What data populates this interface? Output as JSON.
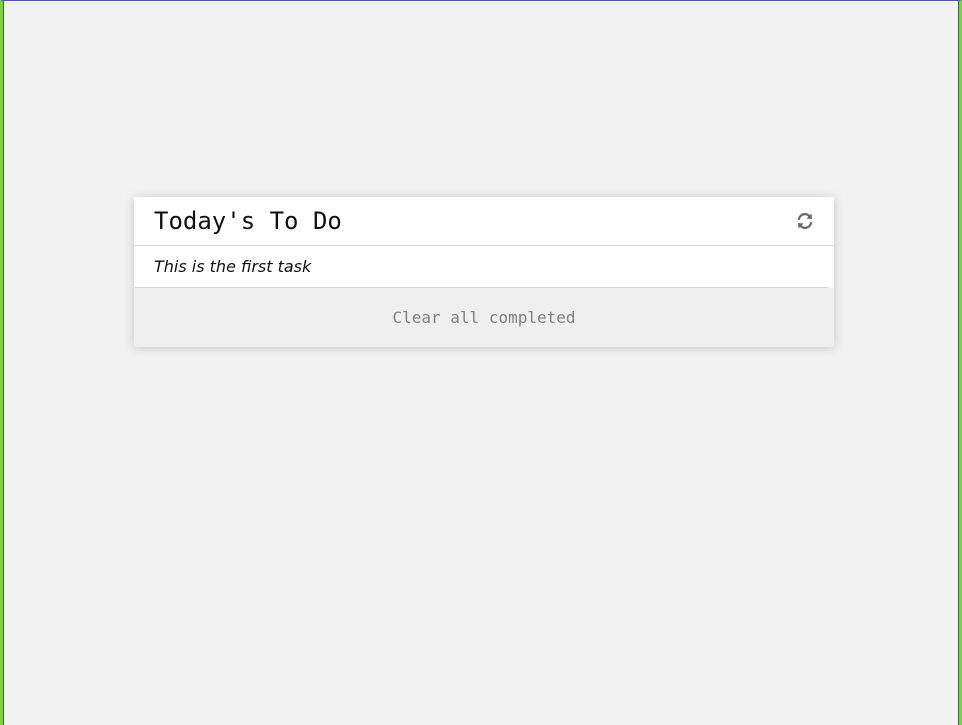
{
  "card": {
    "title": "Today's To Do",
    "refresh_icon": "refresh-icon",
    "tasks": [
      {
        "text": "This is the first task"
      }
    ],
    "footer": {
      "clear_label": "Clear all completed"
    }
  },
  "colors": {
    "background": "#f2f2f2",
    "card": "#ffffff",
    "footer": "#efefef",
    "muted_text": "#808080"
  }
}
